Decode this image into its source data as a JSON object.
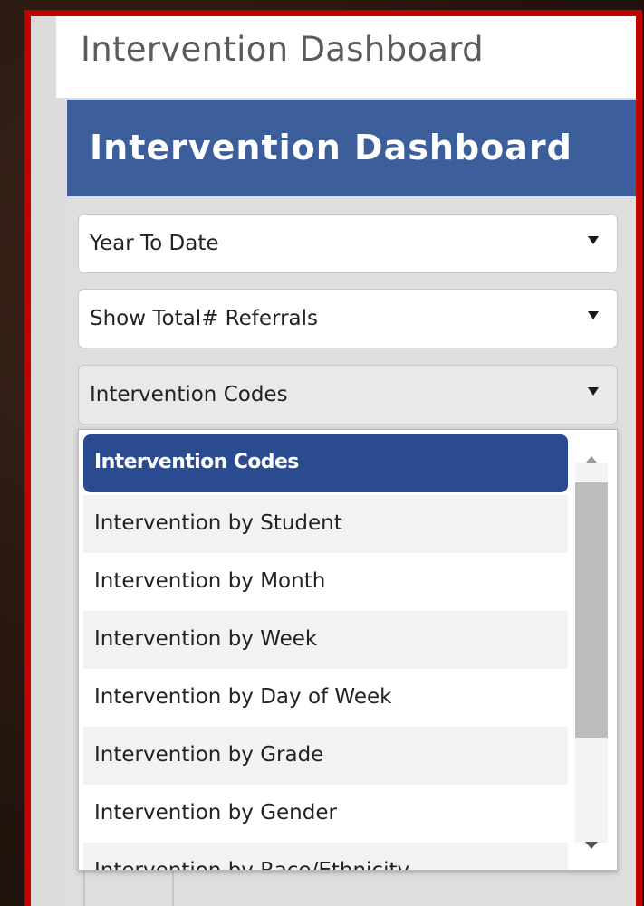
{
  "page": {
    "title": "Intervention Dashboard"
  },
  "header": {
    "title": "Intervention Dashboard"
  },
  "filters": {
    "period": {
      "value": "Year To Date",
      "icon": "chevron-down-icon"
    },
    "measure": {
      "value": "Show Total# Referrals",
      "icon": "chevron-down-icon"
    },
    "view": {
      "value": "Intervention Codes",
      "icon": "chevron-down-icon"
    }
  },
  "dropdown": {
    "options": [
      "Intervention Codes",
      "Intervention by Student",
      "Intervention by Month",
      "Intervention by Week",
      "Intervention by Day of Week",
      "Intervention by Grade",
      "Intervention by Gender",
      "Intervention by Race/Ethnicity"
    ],
    "selected": "Intervention Codes"
  },
  "colors": {
    "frame_border": "#c20000",
    "header_bg": "#3c5e9a",
    "selected_option_bg": "#2a4b8f"
  }
}
